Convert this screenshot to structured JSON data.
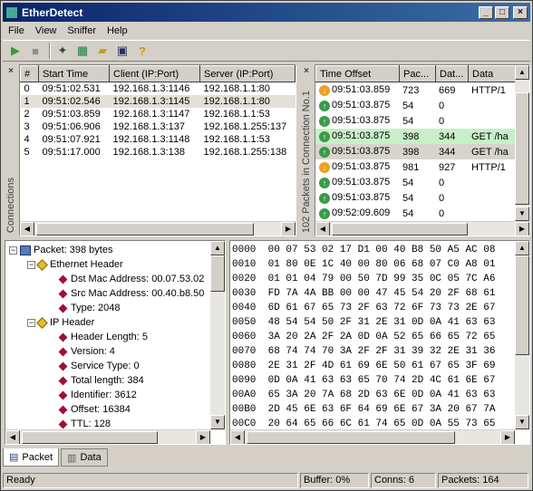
{
  "window": {
    "title": "EtherDetect"
  },
  "menu": [
    {
      "label": "File"
    },
    {
      "label": "View"
    },
    {
      "label": "Sniffer"
    },
    {
      "label": "Help"
    }
  ],
  "connections": {
    "side_label": "Connections",
    "columns": [
      "#",
      "Start Time",
      "Client (IP:Port)",
      "Server (IP:Port)"
    ],
    "rows": [
      [
        "0",
        "09:51:02.531",
        "192.168.1.3:1146",
        "192.168.1.1:80"
      ],
      [
        "1",
        "09:51:02.546",
        "192.168.1.3:1145",
        "192.168.1.1:80"
      ],
      [
        "2",
        "09:51:03.859",
        "192.168.1.3:1147",
        "192.168.1.1:53"
      ],
      [
        "3",
        "09:51:06.906",
        "192.168.1.3:137",
        "192.168.1.255:137"
      ],
      [
        "4",
        "09:51:07.921",
        "192.168.1.3:1148",
        "192.168.1.1:53"
      ],
      [
        "5",
        "09:51:17.000",
        "192.168.1.3:138",
        "192.168.1.255:138"
      ]
    ]
  },
  "packets": {
    "side_label": "102 Packets in Connection No.1",
    "columns": [
      "Time Offset",
      "Pac...",
      "Dat...",
      "Data"
    ],
    "rows": [
      {
        "dir": "down",
        "time": "09:51:03.859",
        "pac": "723",
        "dat": "669",
        "data": "HTTP/1"
      },
      {
        "dir": "up",
        "time": "09:51:03.875",
        "pac": "54",
        "dat": "0",
        "data": ""
      },
      {
        "dir": "up",
        "time": "09:51:03.875",
        "pac": "54",
        "dat": "0",
        "data": ""
      },
      {
        "dir": "up",
        "time": "09:51:03.875",
        "pac": "398",
        "dat": "344",
        "data": "GET /ha"
      },
      {
        "dir": "up",
        "time": "09:51:03.875",
        "pac": "398",
        "dat": "344",
        "data": "GET /ha"
      },
      {
        "dir": "down",
        "time": "09:51:03.875",
        "pac": "981",
        "dat": "927",
        "data": "HTTP/1"
      },
      {
        "dir": "up",
        "time": "09:51:03.875",
        "pac": "54",
        "dat": "0",
        "data": ""
      },
      {
        "dir": "up",
        "time": "09:51:03.875",
        "pac": "54",
        "dat": "0",
        "data": ""
      },
      {
        "dir": "up",
        "time": "09:52:09.609",
        "pac": "54",
        "dat": "0",
        "data": ""
      }
    ]
  },
  "tree": {
    "root": "Packet: 398 bytes",
    "ethernet": "Ethernet Header",
    "dst": "Dst Mac Address: 00.07.53.02",
    "src": "Src Mac Address: 00.40.b8.50",
    "type": "Type: 2048",
    "ip": "IP Header",
    "hlen": "Header Length: 5",
    "ver": "Version: 4",
    "svc": "Service Type: 0",
    "total": "Total length: 384",
    "ident": "Identifier: 3612",
    "offset": "Offset: 16384",
    "ttl": "TTL: 128"
  },
  "hex": [
    "0000  00 07 53 02 17 D1 00 40 B8 50 A5 AC 08",
    "0010  01 80 0E 1C 40 00 80 06 68 07 C0 A8 01",
    "0020  01 01 04 79 00 50 7D 99 35 0C 05 7C A6",
    "0030  FD 7A 4A BB 00 00 47 45 54 20 2F 68 61",
    "0040  6D 61 67 65 73 2F 63 72 6F 73 73 2E 67",
    "0050  48 54 54 50 2F 31 2E 31 0D 0A 41 63 63",
    "0060  3A 20 2A 2F 2A 0D 0A 52 65 66 65 72 65",
    "0070  68 74 74 70 3A 2F 2F 31 39 32 2E 31 36",
    "0080  2E 31 2F 4D 61 69 6E 50 61 67 65 3F 69",
    "0090  0D 0A 41 63 63 65 70 74 2D 4C 61 6E 67",
    "00A0  65 3A 20 7A 68 2D 63 6E 0D 0A 41 63 63",
    "00B0  2D 45 6E 63 6F 64 69 6E 67 3A 20 67 7A",
    "00C0  20 64 65 66 6C 61 74 65 0D 0A 55 73 65"
  ],
  "tabs": [
    {
      "label": "Packet"
    },
    {
      "label": "Data"
    }
  ],
  "status": {
    "ready": "Ready",
    "buffer": "Buffer: 0%",
    "conns": "Conns: 6",
    "packets": "Packets: 164"
  }
}
